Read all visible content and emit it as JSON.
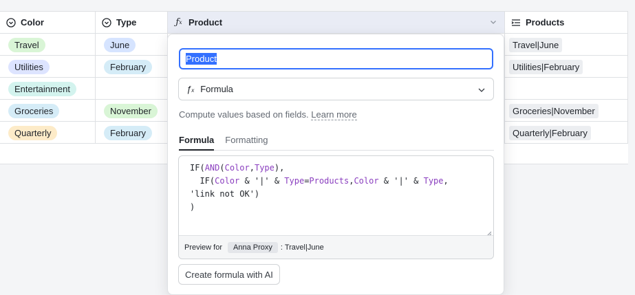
{
  "columns": [
    {
      "label": "Color",
      "icon": "single-select-icon"
    },
    {
      "label": "Type",
      "icon": "single-select-icon"
    },
    {
      "label": "Product",
      "icon": "formula-icon"
    },
    {
      "label": "Products",
      "icon": "text-field-icon"
    }
  ],
  "rows": [
    {
      "color": "Travel",
      "color_bg": "#d9f5d6",
      "type": "June",
      "type_bg": "#d6e4ff",
      "products": "Travel|June"
    },
    {
      "color": "Utilities",
      "color_bg": "#dde4ff",
      "type": "February",
      "type_bg": "#d5ecf7",
      "products": "Utilities|February"
    },
    {
      "color": "Entertainment",
      "color_bg": "#d3f3ee",
      "type": "",
      "type_bg": "",
      "products": ""
    },
    {
      "color": "Groceries",
      "color_bg": "#d5ecf7",
      "type": "November",
      "type_bg": "#d9f5d6",
      "products": "Groceries|November"
    },
    {
      "color": "Quarterly",
      "color_bg": "#fdebc8",
      "type": "February",
      "type_bg": "#d5ecf7",
      "products": "Quarterly|February"
    }
  ],
  "popup": {
    "field_name": "Product",
    "field_type": "Formula",
    "description": "Compute values based on fields.",
    "learn_more": "Learn more",
    "tabs": [
      "Formula",
      "Formatting"
    ],
    "formula_lines": [
      "IF(AND(Color,Type),",
      "  IF(Color & '|' & Type=Products,Color & '|' & Type,",
      "'link not OK')",
      ")"
    ],
    "preview_label": "Preview for",
    "preview_user": "Anna Proxy",
    "preview_value": ": Travel|June",
    "ai_button": "Create formula with AI"
  }
}
